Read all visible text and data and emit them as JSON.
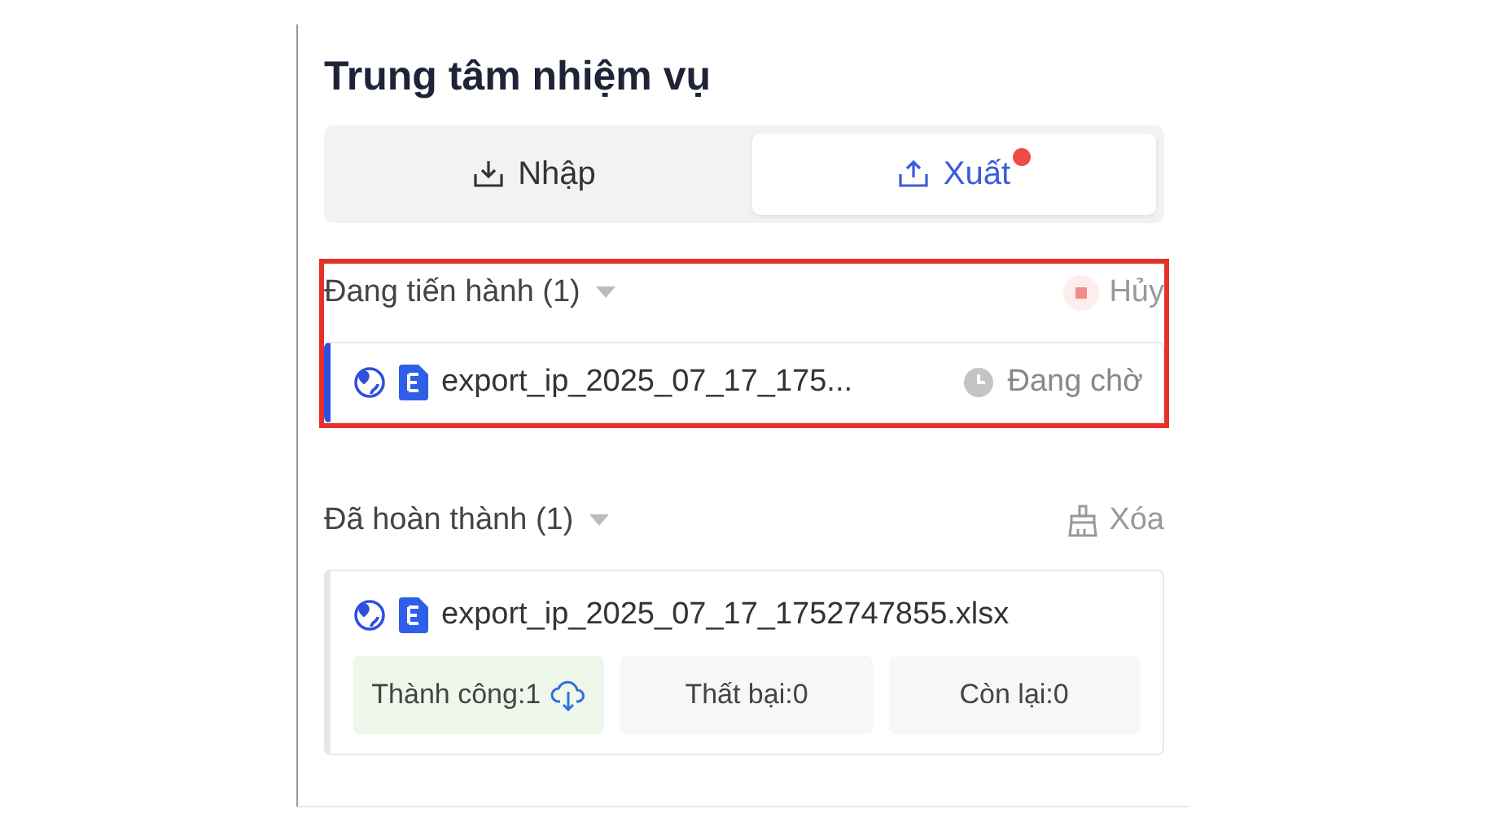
{
  "panel": {
    "title": "Trung tâm nhiệm vụ"
  },
  "tabs": [
    {
      "label": "Nhập",
      "kind": "import",
      "selected": false,
      "badge": false
    },
    {
      "label": "Xuất",
      "kind": "export",
      "selected": true,
      "badge": true
    }
  ],
  "sections": [
    {
      "kind": "in_progress",
      "title": "Đang tiến hành (1)",
      "highlighted": true,
      "action": {
        "label": "Hủy"
      },
      "tasks": [
        {
          "file": "export_ip_2025_07_17_175...",
          "status": "Đang chờ"
        }
      ]
    },
    {
      "kind": "completed",
      "title": "Đã hoàn thành (1)",
      "highlighted": false,
      "action": {
        "label": "Xóa"
      },
      "tasks": [
        {
          "file": "export_ip_2025_07_17_1752747855.xlsx",
          "stats": [
            {
              "label": "Thành công:1",
              "kind": "success"
            },
            {
              "label": "Thất bại:0",
              "kind": "failed"
            },
            {
              "label": "Còn lại:0",
              "kind": "remaining"
            }
          ]
        }
      ]
    }
  ]
}
